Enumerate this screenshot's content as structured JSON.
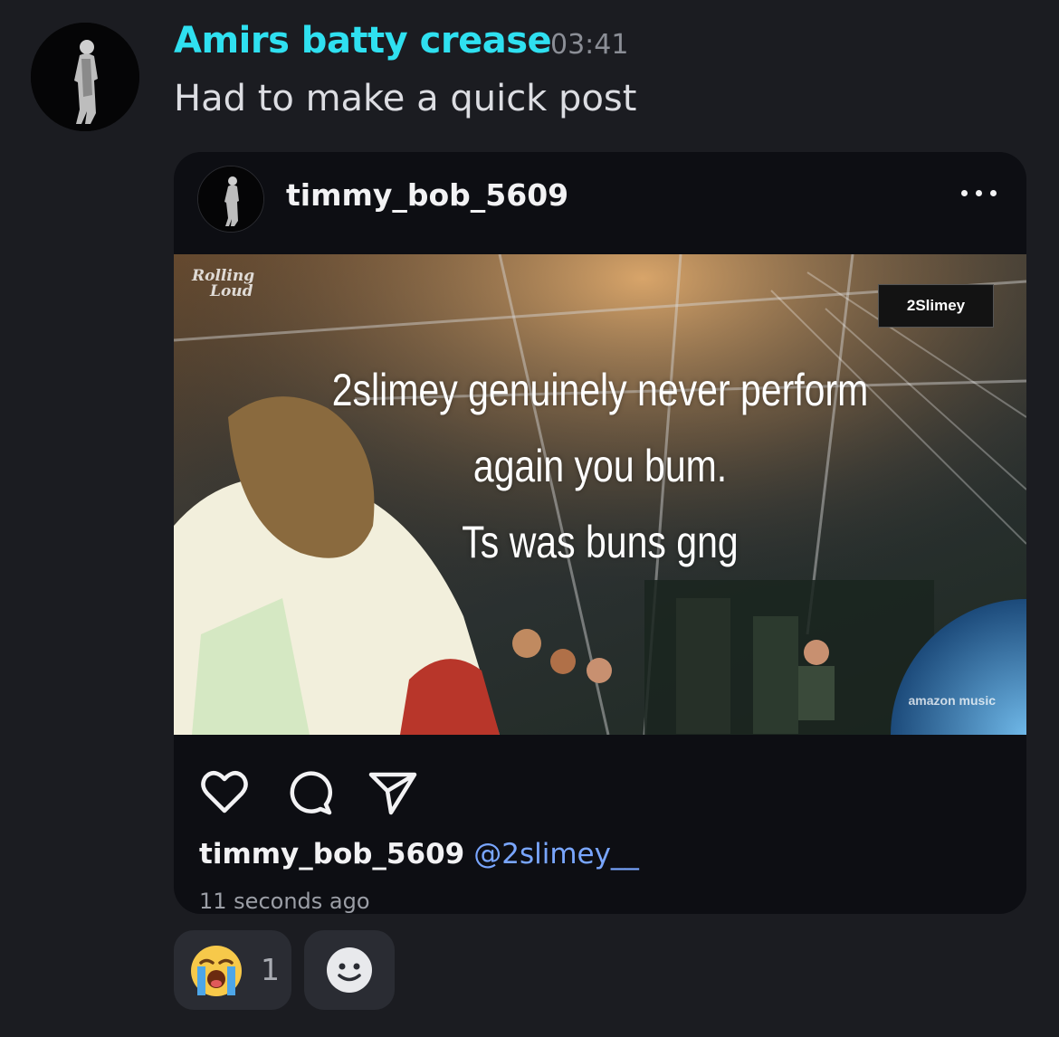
{
  "message": {
    "author": "Amirs batty crease",
    "timestamp": "03:41",
    "text": "Had to make a quick post"
  },
  "embed": {
    "username": "timmy_bob_5609",
    "more_icon": "more-horizontal-icon",
    "media": {
      "overlay_lines": [
        "2slimey genuinely never perform",
        "again you bum.",
        "Ts was buns gng"
      ],
      "corner_tag": "2Slimey",
      "logo_line1": "Rolling",
      "logo_line2": "Loud",
      "watermark": "amazon music"
    },
    "actions": [
      "heart-icon",
      "comment-icon",
      "share-icon"
    ],
    "caption_user": "timmy_bob_5609",
    "caption_mention": "@2slimey__",
    "posted_ago": "11 seconds ago"
  },
  "reactions": [
    {
      "emoji": "loudly-crying-face-icon",
      "count": "1"
    },
    {
      "emoji": "add-reaction-icon"
    }
  ],
  "colors": {
    "background": "#1b1c21",
    "author": "#2fe0f0",
    "mention": "#79a6ff",
    "embed_bg": "#0d0e13"
  }
}
